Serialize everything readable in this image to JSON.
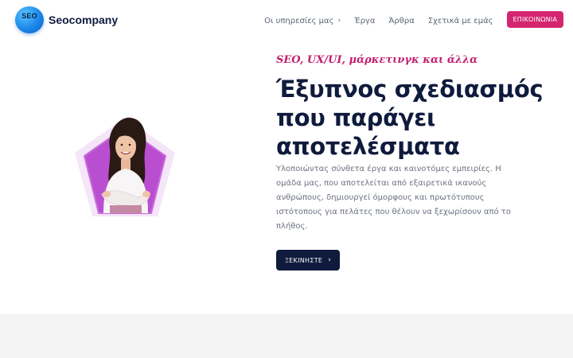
{
  "header": {
    "logo_badge": "SEO",
    "logo_name": "Seocompany",
    "nav": [
      {
        "label": "Οι υπηρεσίες μας",
        "has_dropdown": true
      },
      {
        "label": "Έργα"
      },
      {
        "label": "Άρθρα"
      },
      {
        "label": "Σχετικά με εμάς"
      }
    ],
    "contact_label": "ΕΠΙΚΟΙΝΩΝΙΑ"
  },
  "hero": {
    "tagline": "SEO, UX/UI, μάρκετινγκ και άλλα",
    "headline_line1": "Έξυπνος σχεδιασμός",
    "headline_line2": "που παράγει",
    "headline_line3": "αποτελέσματα",
    "description": "Υλοποιώντας σύνθετα έργα και καινοτόμες εμπειρίες. Η ομάδα μας, που αποτελείται από εξαιρετικά ικανούς ανθρώπους, δημιουργεί όμορφους και πρωτότυπους ιστότοπους για πελάτες που θέλουν να ξεχωρίσουν από το πλήθος.",
    "cta_label": "ΞΕΚΙΝΗΣΤΕ",
    "image": "woman-portrait-on-pink-pentagon"
  },
  "colors": {
    "brand_pink": "#d4266f",
    "navy": "#0f1b3d",
    "tagline": "#c21d6f",
    "logo_blue": "#1a86e8",
    "pentagon": "#b94fd0"
  }
}
